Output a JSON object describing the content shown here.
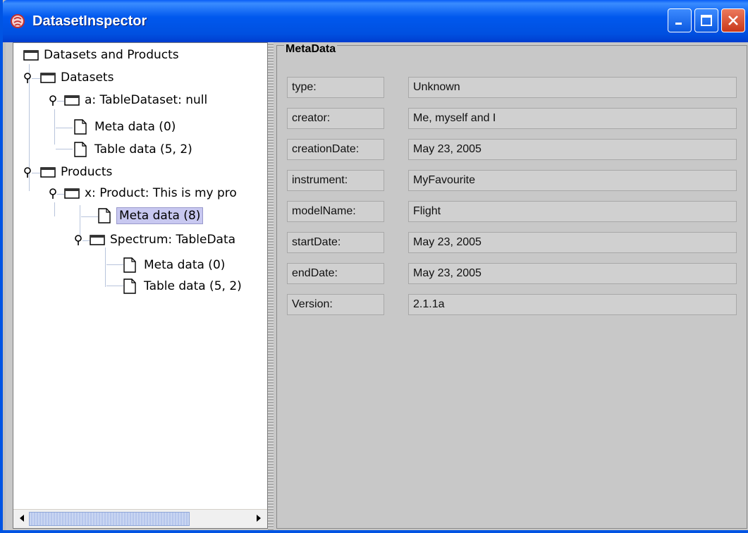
{
  "window": {
    "title": "DatasetInspector",
    "icon": "java-app-icon"
  },
  "tree": {
    "root": "Datasets and Products",
    "nodes": [
      {
        "label": "Datasets",
        "type": "folder"
      },
      {
        "label": "a: TableDataset: null",
        "type": "folder"
      },
      {
        "label": "Meta data (0)",
        "type": "document"
      },
      {
        "label": "Table data (5, 2)",
        "type": "document"
      },
      {
        "label": "Products",
        "type": "folder"
      },
      {
        "label": "x: Product: This is my pro",
        "type": "folder"
      },
      {
        "label": "Meta data (8)",
        "type": "document",
        "selected": true
      },
      {
        "label": "Spectrum: TableData",
        "type": "folder"
      },
      {
        "label": "Meta data (0)",
        "type": "document"
      },
      {
        "label": "Table data (5, 2)",
        "type": "document"
      }
    ]
  },
  "metadata": {
    "title": "MetaData",
    "rows": [
      {
        "key": "type:",
        "value": "Unknown"
      },
      {
        "key": "creator:",
        "value": "Me, myself and I"
      },
      {
        "key": "creationDate:",
        "value": "May 23, 2005"
      },
      {
        "key": "instrument:",
        "value": "MyFavourite"
      },
      {
        "key": "modelName:",
        "value": "Flight"
      },
      {
        "key": "startDate:",
        "value": "May 23, 2005"
      },
      {
        "key": "endDate:",
        "value": "May 23, 2005"
      },
      {
        "key": "Version:",
        "value": "2.1.1a"
      }
    ]
  },
  "colors": {
    "titlebar": "#0054e3",
    "selection": "#c8c8f0",
    "panel": "#c8c8c8"
  }
}
